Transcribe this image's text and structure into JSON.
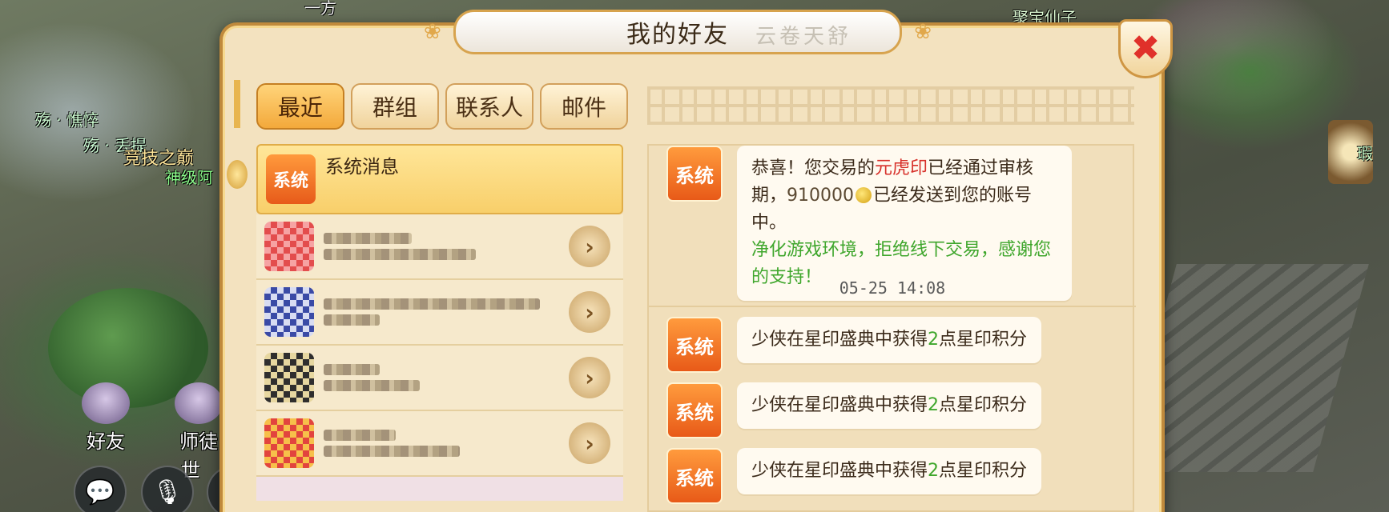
{
  "world": {
    "top_name_1": "一方",
    "top_name_2": "聚宝仙子",
    "player_name_1": "殇 · 憔悴",
    "player_name_2": "殇 · 丢提",
    "player_name_3": "竞技之巅",
    "player_name_4": "神级阿",
    "right_text": "瑕",
    "shi": "世",
    "dock": [
      {
        "label": "好友"
      },
      {
        "label": "师徒"
      }
    ]
  },
  "dialog": {
    "title": "我的好友",
    "title_brush": "云卷天舒",
    "close_symbol": "✖"
  },
  "tabs": [
    {
      "label": "最近",
      "active": true
    },
    {
      "label": "群组",
      "active": false
    },
    {
      "label": "联系人",
      "active": false
    },
    {
      "label": "邮件",
      "active": false
    }
  ],
  "friend_list": {
    "system_item": {
      "icon_text": "系统",
      "title": "系统消息"
    },
    "arrow_glyph": "›"
  },
  "chat": {
    "sender_label": "系统",
    "first_message": {
      "prefix": "恭喜！您交易的",
      "item": "元虎印",
      "mid": "已经通过审核期，",
      "amount": "910000",
      "suffix": "已经发送到您的账号中。",
      "notice": "净化游戏环境，拒绝线下交易，感谢您的支持！"
    },
    "timestamp": "05-25 14:08",
    "points_message": {
      "prefix": "少侠在星印盛典中获得",
      "points": "2",
      "suffix": "点星印积分"
    }
  },
  "colors": {
    "highlight_red": "#d7302a",
    "highlight_green": "#3fa62c",
    "tab_active": "#f3a93b",
    "panel_bg": "#f3e2bf"
  }
}
